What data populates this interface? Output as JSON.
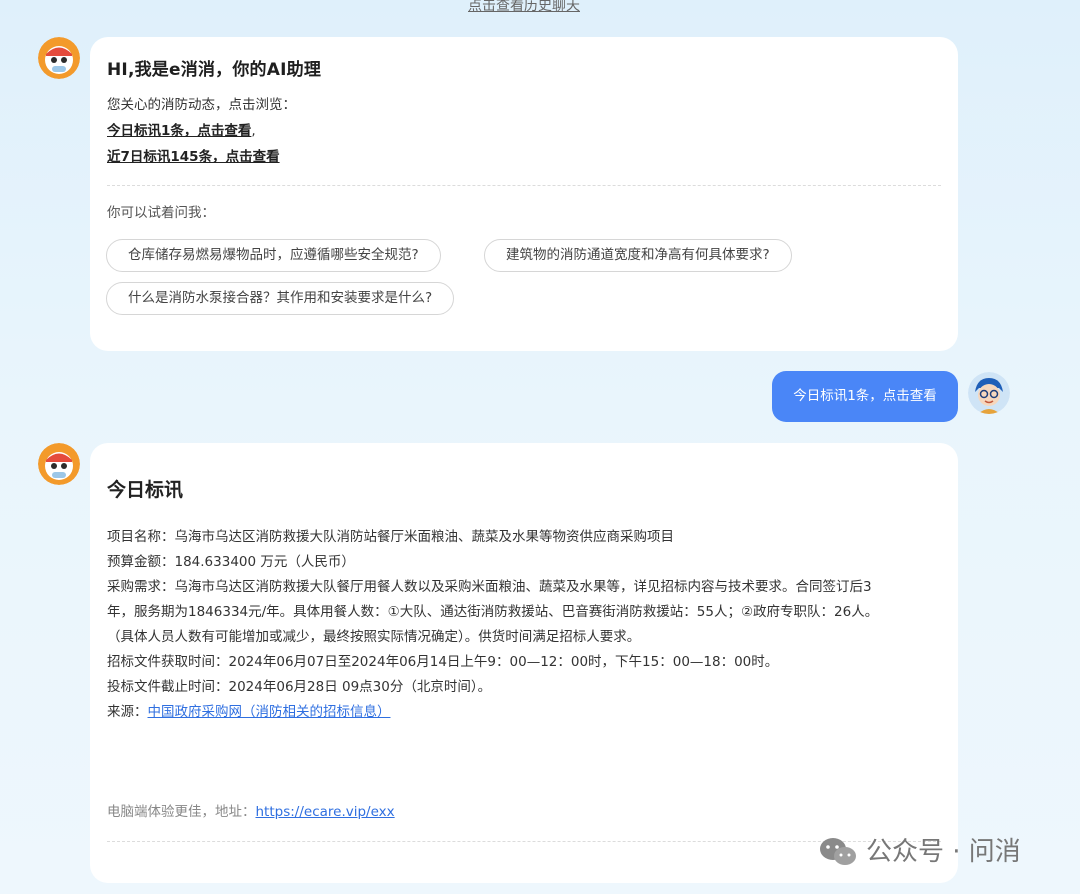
{
  "top": {
    "history_link": "点击查看历史聊天"
  },
  "assistant_greeting": {
    "title": "HI,我是e消消，你的AI助理",
    "intro": "您关心的消防动态，点击浏览：",
    "link_today": "今日标讯1条，点击查看",
    "link_today_suffix": ",",
    "link_week": "近7日标讯145条，点击查看",
    "try_ask": "你可以试着问我：",
    "suggestions": [
      "仓库储存易燃易爆物品时，应遵循哪些安全规范?",
      "建筑物的消防通道宽度和净高有何具体要求?",
      "什么是消防水泵接合器？其作用和安装要求是什么?"
    ]
  },
  "user_message": {
    "text": "今日标讯1条，点击查看"
  },
  "assistant_news": {
    "title": "今日标讯",
    "lines": [
      "项目名称：乌海市乌达区消防救援大队消防站餐厅米面粮油、蔬菜及水果等物资供应商采购项目",
      "预算金额：184.633400 万元（人民币）",
      "采购需求：乌海市乌达区消防救援大队餐厅用餐人数以及采购米面粮油、蔬菜及水果等，详见招标内容与技术要求。合同签订后3",
      "年，服务期为1846334元/年。具体用餐人数：①大队、通达街消防救援站、巴音赛街消防救援站：55人；②政府专职队：26人。",
      "（具体人员人数有可能增加或减少，最终按照实际情况确定）。供货时间满足招标人要求。",
      "招标文件获取时间：2024年06月07日至2024年06月14日上午9：00—12：00时，下午15：00—18：00时。",
      "投标文件截止时间：2024年06月28日 09点30分（北京时间）。"
    ],
    "source_label": "来源：",
    "source_link": "中国政府采购网（消防相关的招标信息）",
    "footer_label": "电脑端体验更佳，地址：",
    "footer_link": "https://ecare.vip/exx"
  },
  "watermark": {
    "text": "公众号 · 问消"
  }
}
